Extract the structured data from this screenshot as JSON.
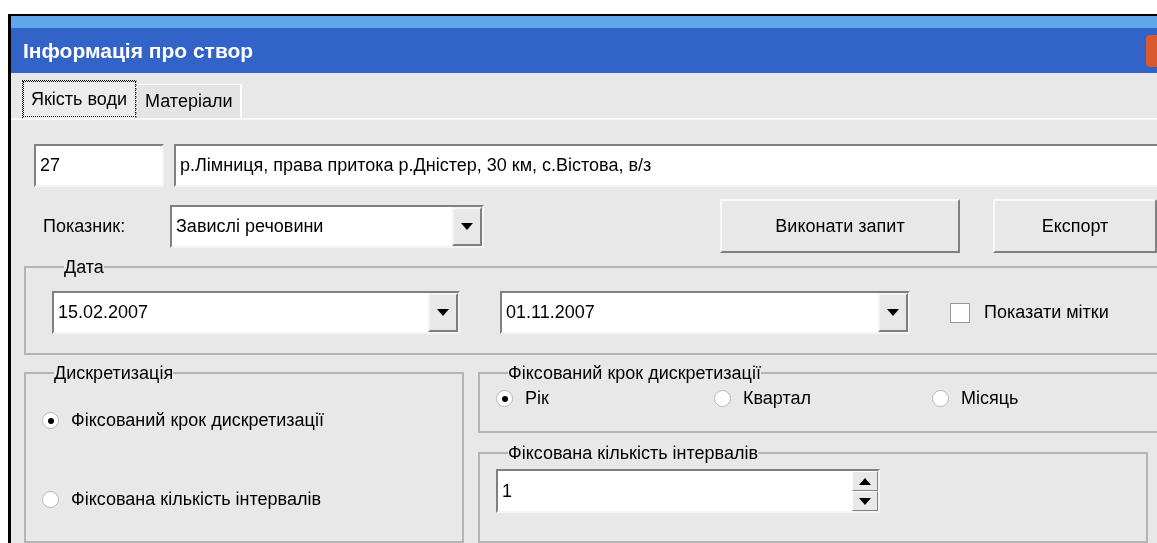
{
  "window": {
    "title": "Інформація про створ"
  },
  "tabs": [
    {
      "label": "Якість води",
      "selected": true
    },
    {
      "label": "Матеріали",
      "selected": false
    }
  ],
  "station": {
    "code": "27",
    "name": "р.Лімниця, права притока р.Дністер, 30 км, с.Вістова, в/з"
  },
  "indicator": {
    "label": "Показник:",
    "value": "Завислі речовини"
  },
  "buttons": [
    "Виконати запит",
    "Експорт"
  ],
  "date_group": {
    "title": "Дата",
    "from": "15.02.2007",
    "to": "01.11.2007",
    "show_marks": {
      "label": "Показати мітки",
      "checked": false
    }
  },
  "discretization": {
    "title": "Дискретизація",
    "options": [
      {
        "label": "Фіксований крок дискретизації",
        "selected": true
      },
      {
        "label": "Фіксована кількість інтервалів",
        "selected": false
      }
    ]
  },
  "fixed_step": {
    "title": "Фіксований крок дискретизації",
    "options": [
      {
        "label": "Рік",
        "selected": true
      },
      {
        "label": "Квартал",
        "selected": false
      },
      {
        "label": "Місяць",
        "selected": false
      }
    ]
  },
  "fixed_count": {
    "title": "Фіксована кількість інтервалів",
    "value": "1"
  }
}
